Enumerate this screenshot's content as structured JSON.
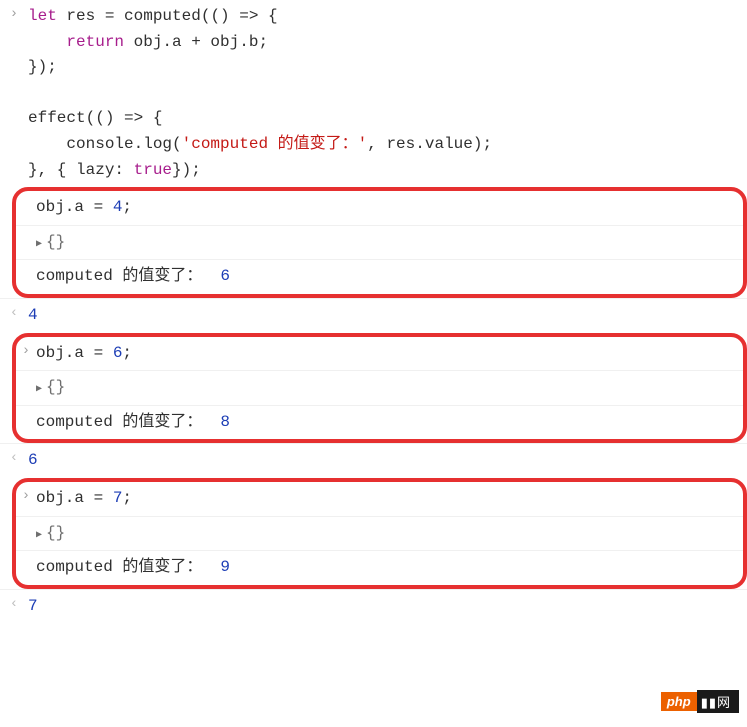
{
  "code": {
    "l1": "let",
    "l1b": " res = computed(() => {",
    "l2a": "    ",
    "l2b": "return",
    "l2c": " obj.a + obj.b;",
    "l3": "});",
    "l4": "",
    "l5": "effect(() => {",
    "l6a": "    console.log(",
    "l6b": "'computed 的值变了：'",
    "l6c": ", res.value);",
    "l7a": "}, { lazy: ",
    "l7b": "true",
    "l7c": "});"
  },
  "blocks": [
    {
      "assign_lhs": "obj.a = ",
      "assign_val": "4",
      "assign_end": ";",
      "obj": "{}",
      "log_text": "computed 的值变了：",
      "log_val": "6",
      "output": "4"
    },
    {
      "assign_lhs": "obj.a = ",
      "assign_val": "6",
      "assign_end": ";",
      "obj": "{}",
      "log_text": "computed 的值变了：",
      "log_val": "8",
      "output": "6"
    },
    {
      "assign_lhs": "obj.a = ",
      "assign_val": "7",
      "assign_end": ";",
      "obj": "{}",
      "log_text": "computed 的值变了：",
      "log_val": "9",
      "output": "7"
    }
  ],
  "glyphs": {
    "input": "›",
    "output": "‹",
    "triangle": "▶"
  },
  "watermark": {
    "tag": "php",
    "rest": "▮▮网"
  }
}
